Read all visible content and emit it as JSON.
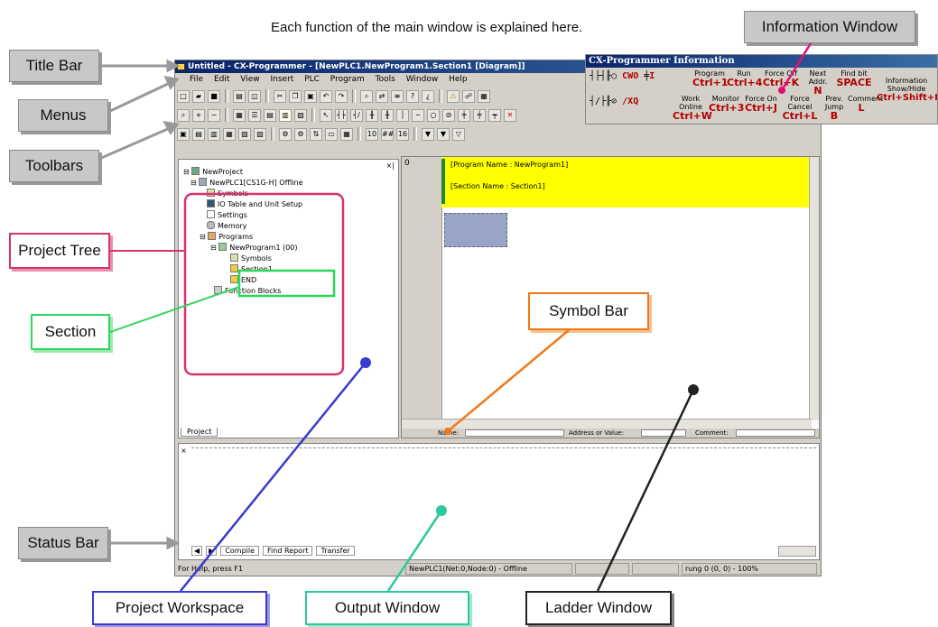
{
  "heading": "Each function of the main window is explained here.",
  "callouts": {
    "title_bar": "Title Bar",
    "menus": "Menus",
    "toolbars": "Toolbars",
    "project_tree": "Project Tree",
    "section": "Section",
    "status_bar": "Status Bar",
    "information_window": "Information Window",
    "symbol_bar": "Symbol Bar",
    "project_workspace": "Project Workspace",
    "output_window": "Output Window",
    "ladder_window": "Ladder Window"
  },
  "colors": {
    "project_tree": "#d8336e",
    "section": "#2ed65a",
    "symbol_bar": "#f07818",
    "project_workspace": "#3a3ad0",
    "output_window": "#2ec8a0",
    "ladder_window": "#222222",
    "info_pointer": "#e0107a"
  },
  "app": {
    "title": "Untitled - CX-Programmer - [NewPLC1.NewProgram1.Section1 [Diagram]]",
    "menus": [
      "File",
      "Edit",
      "View",
      "Insert",
      "PLC",
      "Program",
      "Tools",
      "Window",
      "Help"
    ],
    "tree": {
      "root": "NewProject",
      "plc": "NewPLC1[CS1G-H] Offline",
      "symbols": "Symbols",
      "io_table": "IO Table and Unit Setup",
      "settings": "Settings",
      "memory": "Memory",
      "programs": "Programs",
      "program1": "NewProgram1 (00)",
      "prog_symbols": "Symbols",
      "section1": "Section1",
      "end": "END",
      "function_blocks": "Function Blocks"
    },
    "project_tab": "Project",
    "ladder": {
      "rung_number": "0",
      "program_name": "[Program Name : NewProgram1]",
      "section_name": "[Section Name : Section1]"
    },
    "symbolbar": {
      "name_label": "Name:",
      "address_label": "Address or Value:",
      "comment_label": "Comment:"
    },
    "output_tabs": [
      "Compile",
      "Find Report",
      "Transfer"
    ],
    "status": {
      "help": "For Help, press F1",
      "plc_status": "NewPLC1(Net:0,Node:0) - Offline",
      "rung_info": "rung 0 (0, 0) - 100%"
    }
  },
  "info_window": {
    "title": "CX-Programmer Information",
    "row1": [
      {
        "label": "Program",
        "key": "Ctrl+1"
      },
      {
        "label": "Run",
        "key": "Ctrl+4"
      },
      {
        "label": "Force Off",
        "key": "Ctrl+K"
      },
      {
        "label": "Next Addr.",
        "key": "N"
      },
      {
        "label": "Find bit",
        "key": "SPACE"
      }
    ],
    "row2": [
      {
        "label": "Work Online",
        "key": "Ctrl+W"
      },
      {
        "label": "Monitor",
        "key": "Ctrl+3"
      },
      {
        "label": "Force On",
        "key": "Ctrl+J"
      },
      {
        "label": "Force Cancel",
        "key": "Ctrl+L"
      },
      {
        "label": "Prev. Jump",
        "key": "B"
      },
      {
        "label": "Comment",
        "key": "L"
      }
    ],
    "info_label": "Information Show/Hide",
    "info_key": "Ctrl+Shift+I",
    "symbol_keys_row1": [
      "C",
      "W",
      "O",
      "I"
    ],
    "symbol_keys_row2": [
      "/",
      "X",
      "Q"
    ]
  }
}
